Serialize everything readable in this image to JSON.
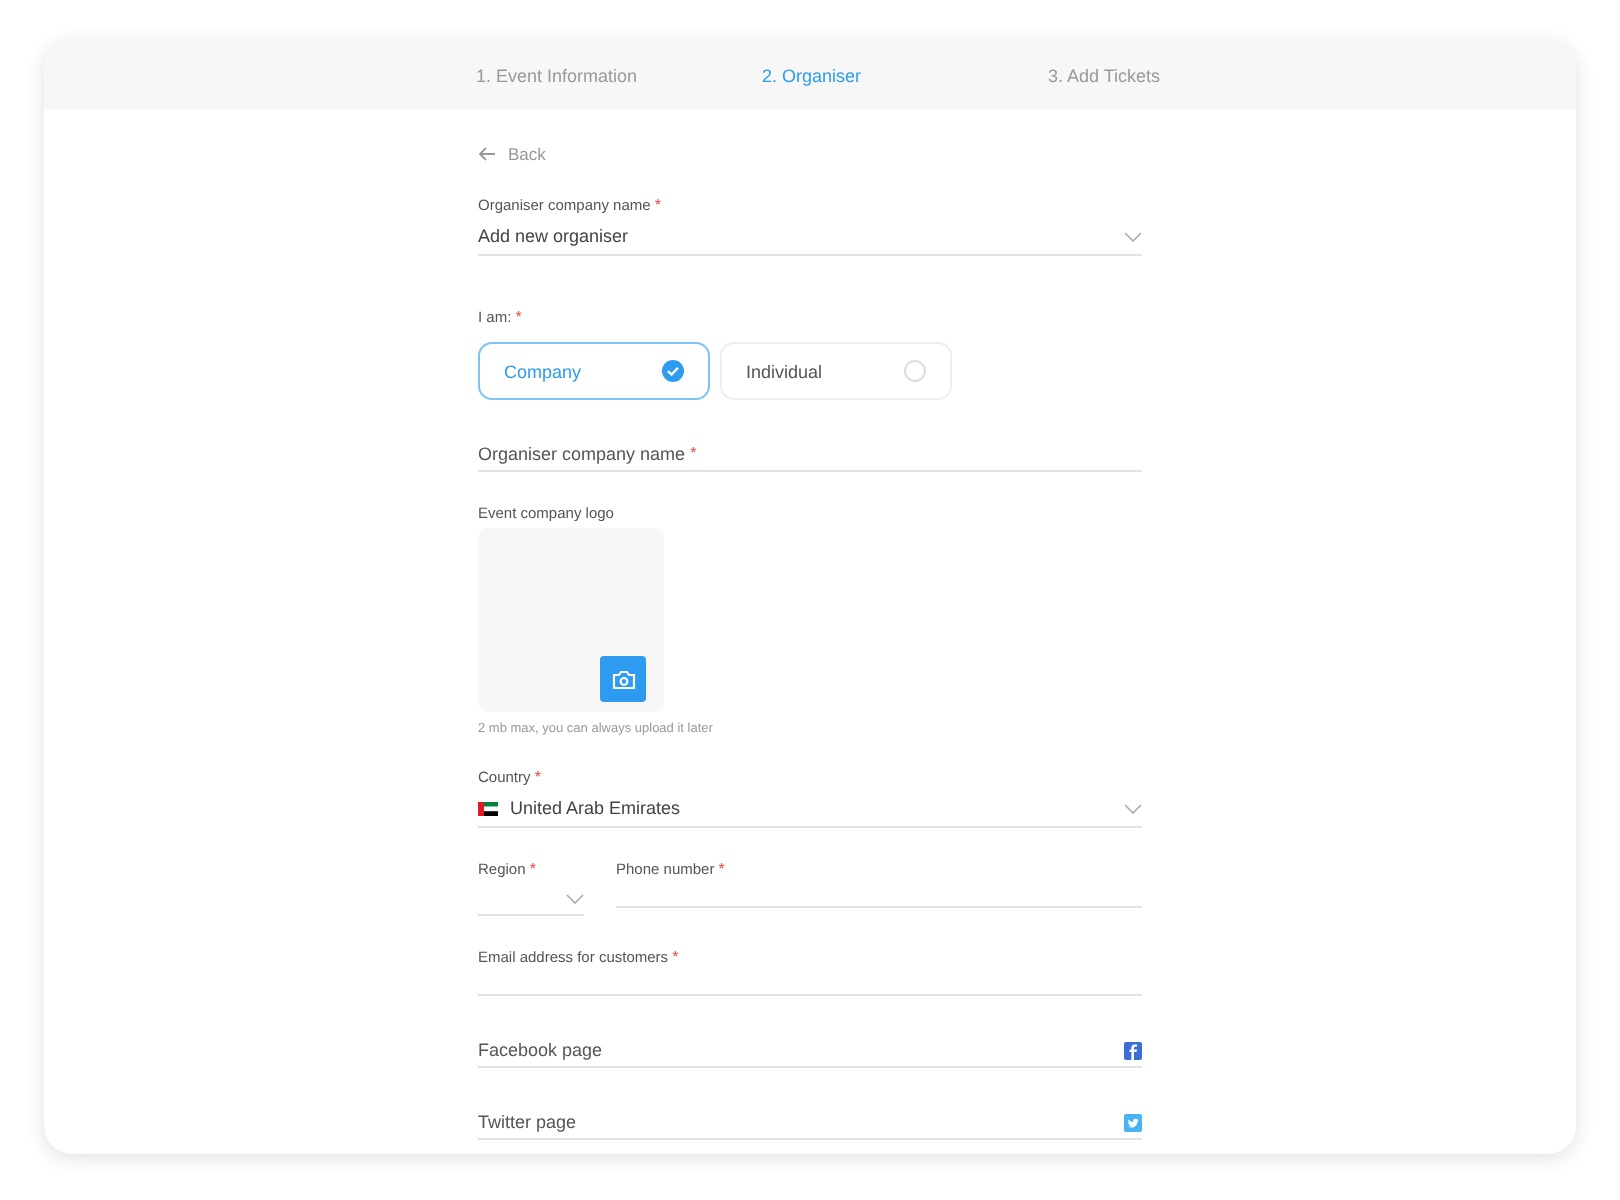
{
  "steps": [
    {
      "label": "1. Event Information",
      "selected": false
    },
    {
      "label": "2. Organiser",
      "selected": true
    },
    {
      "label": "3. Add Tickets",
      "selected": false
    }
  ],
  "back": "Back",
  "fields": [
    {
      "kind": "select",
      "label": "Organiser company name",
      "asterisk": "*",
      "value": "Add new organiser"
    },
    {
      "kind": "choice",
      "label": "I am:",
      "asterisk": "*",
      "options": [
        {
          "label": "Company",
          "selected": true
        },
        {
          "label": "Individual",
          "selected": false
        }
      ]
    },
    {
      "kind": "inline",
      "placeholder": "Organiser company name",
      "asterisk": "*"
    },
    {
      "kind": "logo",
      "label": "Event company logo",
      "hint": "2 mb max, you can always upload it later"
    },
    {
      "kind": "country",
      "label": "Country",
      "asterisk": "*",
      "value": "United Arab Emirates"
    },
    {
      "kind": "pair",
      "items": [
        {
          "kind": "select",
          "label": "Region",
          "asterisk": "*"
        },
        {
          "kind": "text",
          "label": "Phone number",
          "asterisk": "*"
        }
      ]
    },
    {
      "kind": "text",
      "label": "Email address for customers",
      "asterisk": "*"
    },
    {
      "kind": "facebook",
      "placeholder": "Facebook page"
    },
    {
      "kind": "twitter",
      "placeholder": "Twitter page"
    }
  ]
}
